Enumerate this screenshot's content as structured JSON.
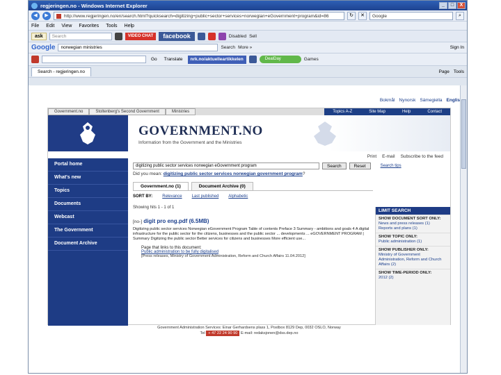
{
  "window": {
    "title": "regjeringen.no - Windows Internet Explorer",
    "min": "_",
    "max": "□",
    "close": "X"
  },
  "address": {
    "url": "http://www.regjeringen.no/en/search.html?quicksearch=digitizing+public+sector+services+norwegian+eGovernment+program&id=86",
    "search_placeholder": "Google",
    "refresh": "↻",
    "stop": "✕",
    "search_btn": "⌕"
  },
  "menu": [
    "File",
    "Edit",
    "View",
    "Favorites",
    "Tools",
    "Help"
  ],
  "toolbar": {
    "ask_logo": "ask",
    "search_placeholder": "Search",
    "video_chat": "VIDEO CHAT",
    "facebook": "facebook",
    "disabled": "Disabled",
    "ebaylabel": "Sell"
  },
  "google": {
    "logo": "Google",
    "query": "norwegian ministries",
    "search_btn": "Search",
    "more": "More »",
    "sign_in": "Sign In"
  },
  "links_bar": {
    "go": "Go",
    "translate": "Translate",
    "tab": "nrk.no/aktuelleartikkelen",
    "green": "DealDay",
    "games": "Games"
  },
  "tabs": {
    "page_tab": "Search - regjeringen.no",
    "tools": [
      "Page",
      "Tools"
    ]
  },
  "lang_bar": [
    "Bokmål",
    "Nynorsk",
    "Sámegiella",
    "English"
  ],
  "site": {
    "topnav_left": [
      "Government.no",
      "Stoltenberg's Second Government",
      "Ministries"
    ],
    "topnav_right": [
      "Topics A-Z",
      "Site Map",
      "Help",
      "Contact"
    ],
    "title": "GOVERNMENT.NO",
    "tagline": "Information from the Government and the Ministries",
    "utility": [
      "Print",
      "E-mail",
      "Subscribe to the feed"
    ],
    "left_nav": [
      "Portal home",
      "What's new",
      "Topics",
      "Documents",
      "Webcast",
      "The Government",
      "Document Archive"
    ],
    "search_value": "digitizing public sector services norwegian eGovernment program",
    "search_btn": "Search",
    "reset_btn": "Reset",
    "search_tips": "Search tips",
    "did_you_mean_prefix": "Did you mean:",
    "did_you_mean": "digitizing public sector services norwegian government program",
    "did_you_mean_q": "?",
    "res_tabs": [
      "Government.no (1)",
      "Document Archive (0)"
    ],
    "sort_label": "SORT BY:",
    "sort_opts": [
      "Relevance",
      "Last published",
      "Alphabetic"
    ],
    "showing": "Showing hits 1 - 1 of 1",
    "doc_prefix": "[no-]",
    "doc_title": "digit pro eng.pdf (6.5MB)",
    "snippet": "Digitizing public sector services Norwegian eGovernment Program Table of contents Preface 3 Summary - ambitions and goals 4 A digital infrastructure for the public sector for the citizens, businesses and the public sector ... developments ... eGOVERNMENT PROGRAM | Summary Digitizing the public sector Better services for citizens and businesses More efficient use...",
    "pages_label": "Page that links to this document:",
    "pages_link": "Public administration to be fully digitalised",
    "pages_meta": "[Press releases, Ministry of Government Administration, Reform and Church Affairs 11.04.2012]",
    "limit_head": "LIMIT SEARCH",
    "limit": [
      {
        "h": "SHOW DOCUMENT SORT ONLY:",
        "o": [
          "News and press releases (1)",
          "Reports and plans (1)"
        ]
      },
      {
        "h": "SHOW TOPIC ONLY:",
        "o": [
          "Public administration (1)"
        ]
      },
      {
        "h": "SHOW PUBLISHER ONLY:",
        "o": [
          "Ministry of Government Administration, Reform and Church Affairs (2)"
        ]
      },
      {
        "h": "SHOW TIME-PERIOD ONLY:",
        "o": [
          "2012 (2)"
        ]
      }
    ],
    "footer_line1": "Government Administration Services: Einar Gerhardsens plass 1, Postbox 8129 Dep, 0032 OSLO, Norway",
    "footer_tel_label": "Tel",
    "footer_tel": "+ 47 22 24 90 90",
    "footer_email": "E-mail: redaksjonen@dss.dep.no"
  }
}
